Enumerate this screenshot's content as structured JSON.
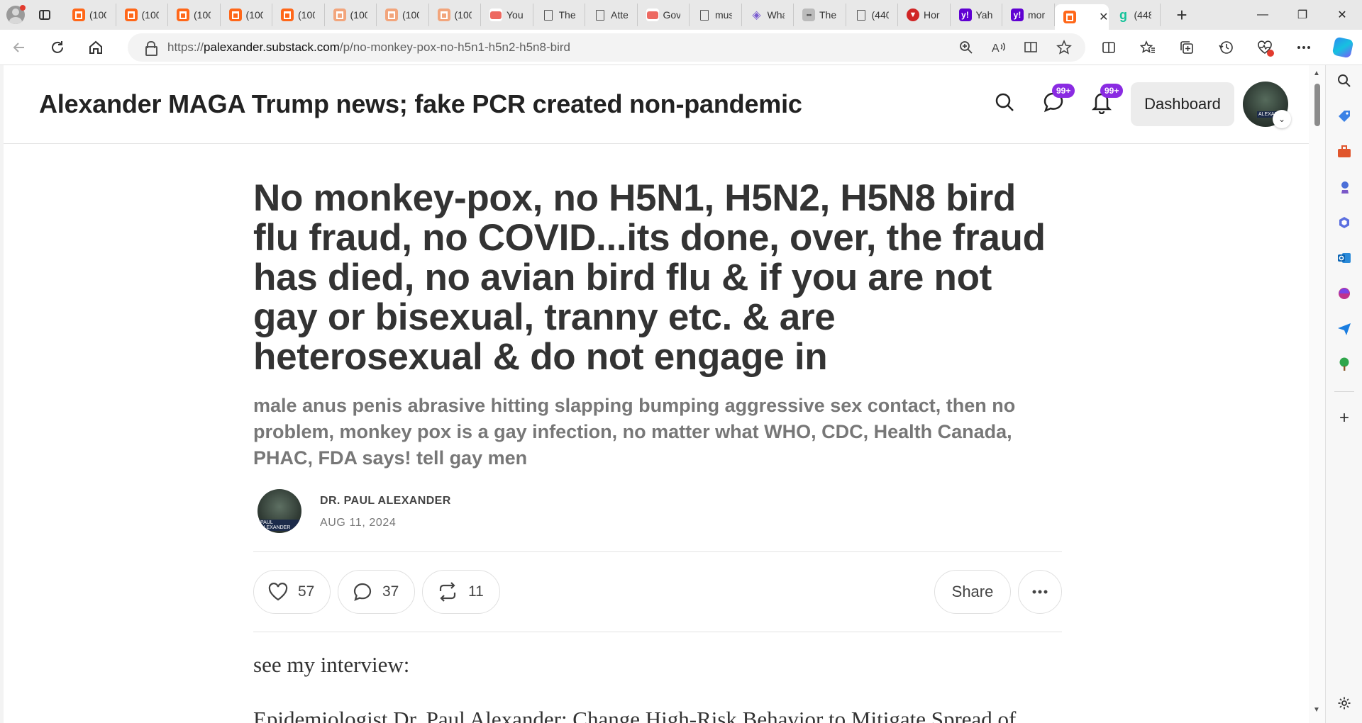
{
  "browser": {
    "tabs": [
      {
        "label": "(100",
        "icon": "substack-icon"
      },
      {
        "label": "(100",
        "icon": "substack-icon"
      },
      {
        "label": "(100",
        "icon": "substack-icon"
      },
      {
        "label": "(100",
        "icon": "substack-icon"
      },
      {
        "label": "(100",
        "icon": "substack-icon"
      },
      {
        "label": "(100",
        "icon": "substack-faded-icon"
      },
      {
        "label": "(100",
        "icon": "substack-faded-icon"
      },
      {
        "label": "(100",
        "icon": "substack-faded-icon"
      },
      {
        "label": "You",
        "icon": "youtube-icon"
      },
      {
        "label": "The",
        "icon": "document-icon"
      },
      {
        "label": "Atte",
        "icon": "document-icon"
      },
      {
        "label": "Gov",
        "icon": "youtube-icon"
      },
      {
        "label": "mus",
        "icon": "document-icon"
      },
      {
        "label": "Wha",
        "icon": "purple-app-icon"
      },
      {
        "label": "The",
        "icon": "dots-icon"
      },
      {
        "label": "(440",
        "icon": "document-icon"
      },
      {
        "label": "Hor",
        "icon": "red-app-icon"
      },
      {
        "label": "Yah",
        "icon": "yahoo-icon"
      },
      {
        "label": "mor",
        "icon": "yahoo-icon"
      },
      {
        "label": "",
        "icon": "substack-icon",
        "active": true
      },
      {
        "label": "(448",
        "icon": "grammarly-icon"
      }
    ],
    "new_tab_glyph": "+",
    "window": {
      "minimize": "—",
      "restore": "❐",
      "close": "✕"
    },
    "url_prefix": "https://",
    "url_domain": "palexander.substack.com",
    "url_path": "/p/no-monkey-pox-no-h5n1-h5n2-h5n8-bird"
  },
  "site": {
    "publication_title": "Alexander MAGA Trump news; fake PCR created non-pandemic",
    "chat_badge": "99+",
    "notifications_badge": "99+",
    "dashboard_label": "Dashboard",
    "avatar_caption": "ALEXANDER"
  },
  "post": {
    "title": "No monkey-pox, no H5N1, H5N2, H5N8 bird flu fraud, no COVID...its done, over, the fraud has died, no avian bird flu & if you are not gay or bisexual, tranny etc. & are heterosexual & do not engage in",
    "subtitle": "male anus penis abrasive hitting slapping bumping aggressive sex contact, then no problem, monkey pox is a gay infection, no matter what WHO, CDC, Health Canada, PHAC, FDA says! tell gay men",
    "author": "DR. PAUL ALEXANDER",
    "author_avatar_caption": "PAUL ALEXANDER",
    "date": "AUG 11, 2024",
    "likes": "57",
    "comments": "37",
    "restacks": "11",
    "share_label": "Share",
    "body_intro": "see my interview:",
    "body_next_line": "Epidemiologist Dr. Paul Alexander: Change High-Risk Behavior to Mitigate Spread of"
  }
}
